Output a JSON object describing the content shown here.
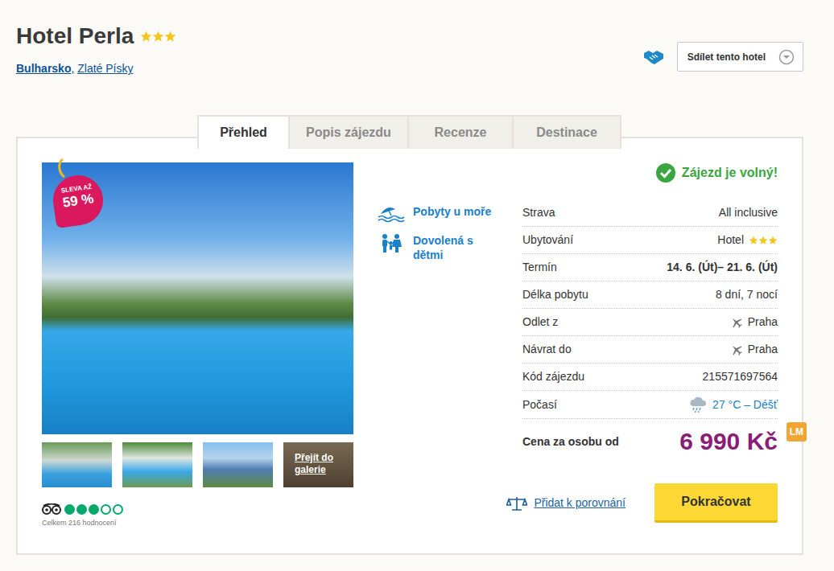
{
  "hotel": {
    "name": "Hotel Perla",
    "stars": 3
  },
  "breadcrumb": [
    {
      "label": "Bulharsko"
    },
    {
      "label": "Zlaté Písky"
    }
  ],
  "breadcrumb_separator": ",",
  "share": {
    "label": "Sdílet tento hotel"
  },
  "tabs": [
    {
      "label": "Přehled",
      "selected": true
    },
    {
      "label": "Popis zájezdu",
      "selected": false
    },
    {
      "label": "Recenze",
      "selected": false
    },
    {
      "label": "Destinace",
      "selected": false
    }
  ],
  "gallery": {
    "badge_top": "SLEVA AŽ",
    "badge_value": "59 %",
    "more": "Přejít do galerie"
  },
  "rating": {
    "stars": 3,
    "max": 5,
    "count": "Celkem 216 hodnocení"
  },
  "categories": [
    {
      "label": "Pobyty u moře",
      "kind": "sea"
    },
    {
      "label": "Dovolená s dětmi",
      "kind": "family"
    }
  ],
  "availability": "Zájezd je volný!",
  "details": [
    {
      "label": "Strava",
      "value": "All inclusive",
      "kind": "text"
    },
    {
      "label": "Ubytování",
      "value": "Hotel",
      "kind": "stars",
      "stars": 3
    },
    {
      "label": "Termín",
      "value": "14. 6. (Út)– 21. 6. (Út)",
      "kind": "date"
    },
    {
      "label": "Délka pobytu",
      "value": "8 dní, 7 nocí",
      "kind": "text"
    },
    {
      "label": "Odlet z",
      "value": "Praha",
      "kind": "plane"
    },
    {
      "label": "Návrat do",
      "value": "Praha",
      "kind": "plane"
    },
    {
      "label": "Kód zájezdu",
      "value": "215571697564",
      "kind": "text"
    },
    {
      "label": "Počasí",
      "value": "27 °C – Déšť",
      "kind": "weather"
    }
  ],
  "price": {
    "label": "Cena za osobu od",
    "value": "6 990 Kč",
    "badge": "LM"
  },
  "compare": "Přidat k porovnání",
  "continue": "Pokračovat"
}
